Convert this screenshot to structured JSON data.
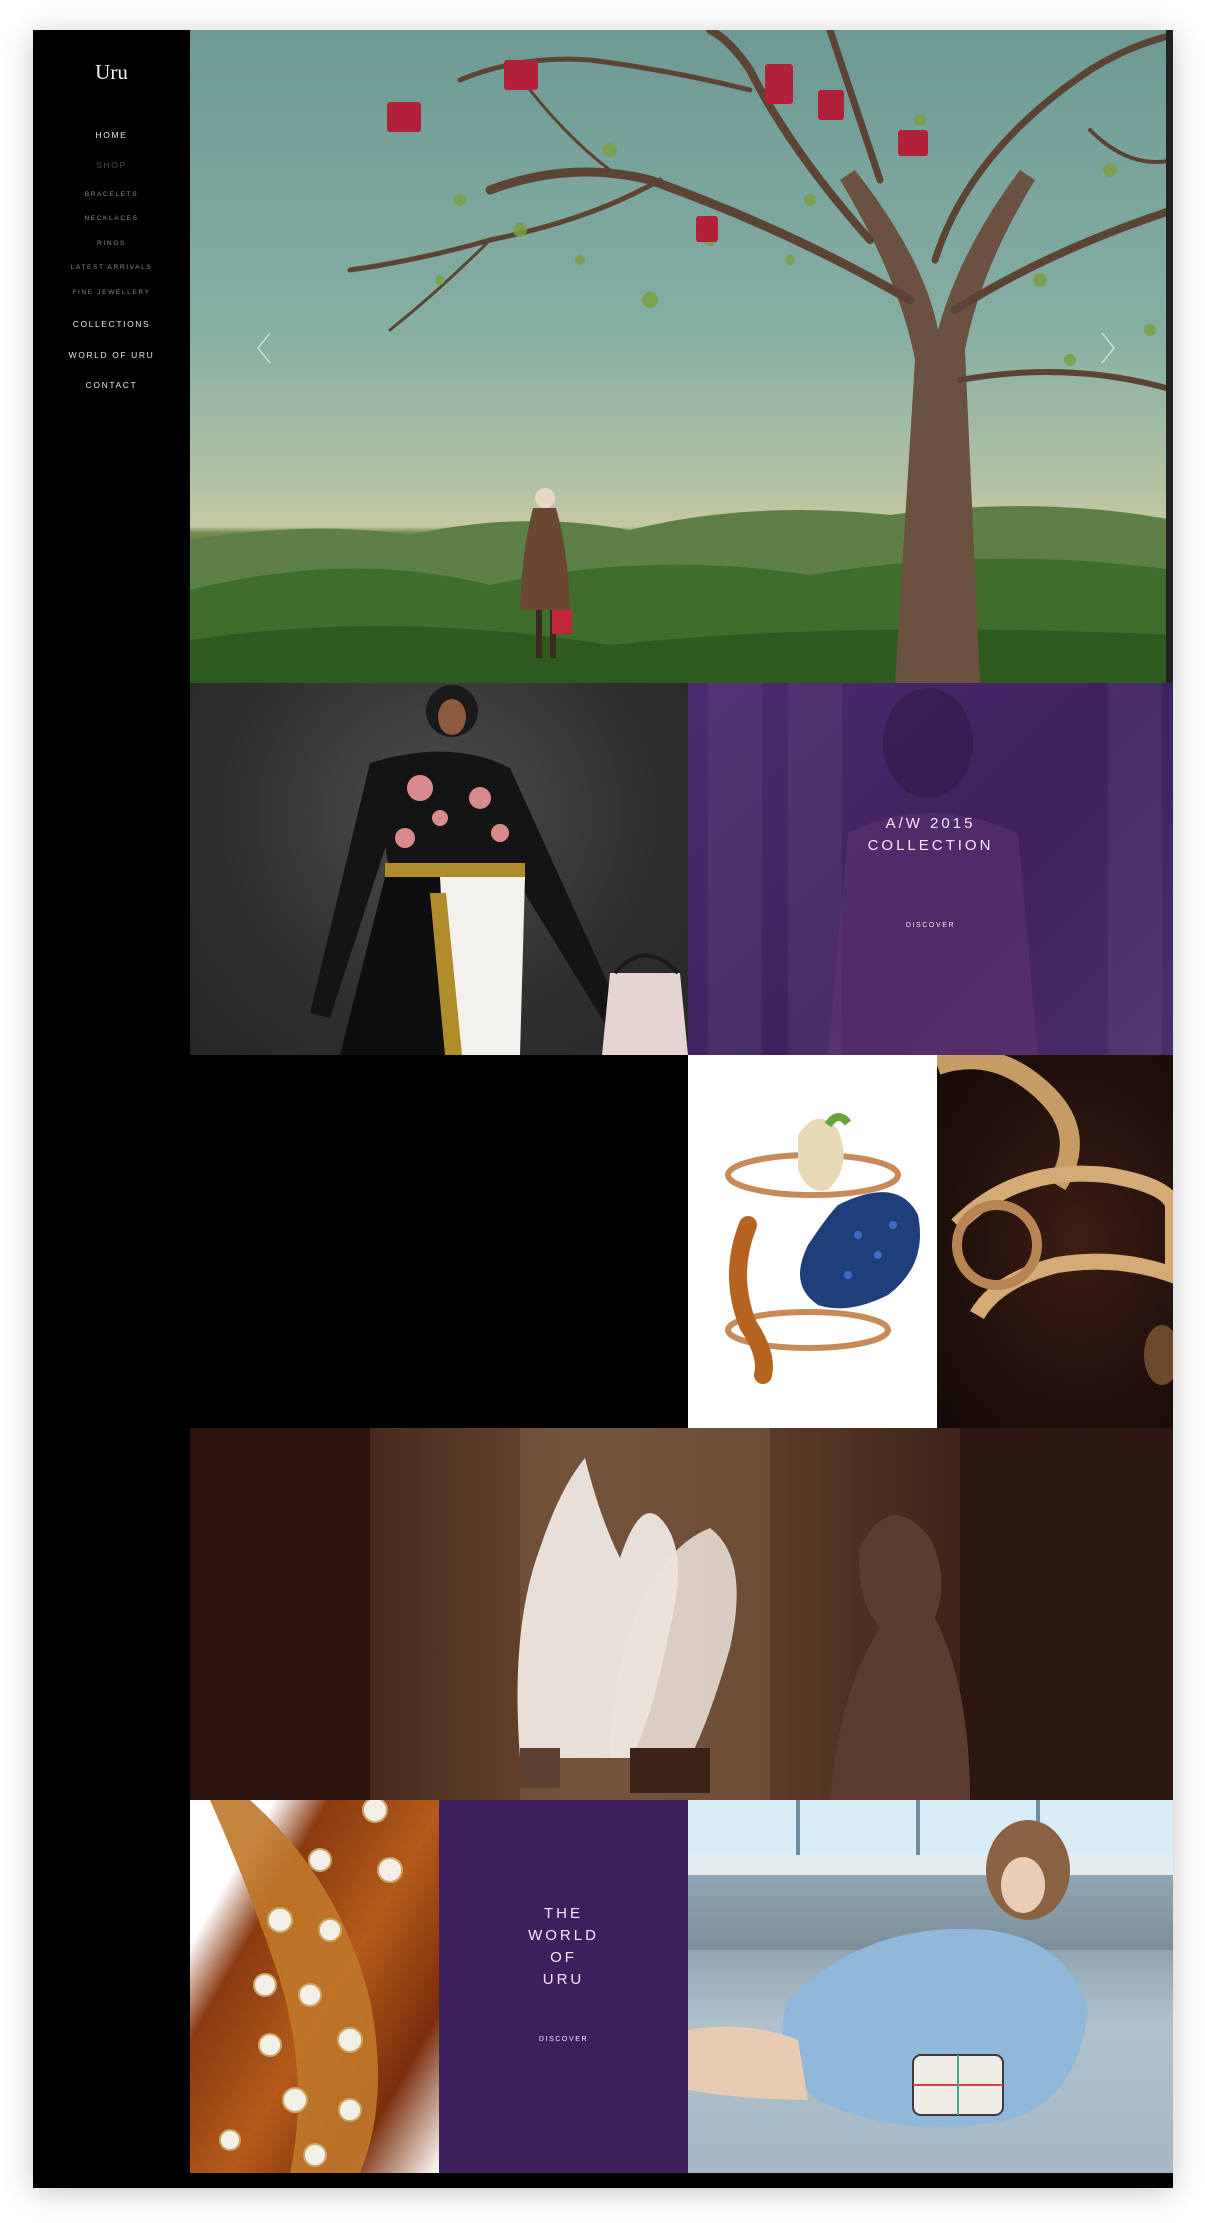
{
  "brand": {
    "logo": "Uru"
  },
  "nav": {
    "home": "Home",
    "shop": "Shop",
    "shop_items": [
      "Bracelets",
      "Necklaces",
      "Rings",
      "Latest Arrivals",
      "Fine Jewellery"
    ],
    "collections": "Collections",
    "world": "World of Uru",
    "contact": "Contact"
  },
  "tiles": {
    "collection": {
      "title_line1": "A/W 2015",
      "title_line2": "Collection",
      "link": "Discover"
    },
    "world": {
      "lines": [
        "The",
        "World",
        "of",
        "Uru"
      ],
      "link": "Discover"
    }
  },
  "colors": {
    "sidebar": "#000000",
    "purple_tile": "#3e1f5e",
    "overlay_text": "#f0eaf6"
  },
  "icons": {
    "prev": "chevron-left-icon",
    "next": "chevron-right-icon"
  }
}
